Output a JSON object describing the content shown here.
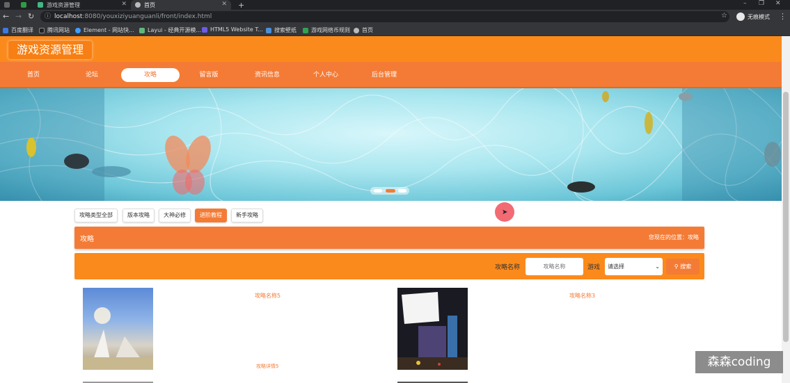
{
  "browser": {
    "tabs": [
      {
        "title": ""
      },
      {
        "title": ""
      },
      {
        "title": "游戏资源管理"
      },
      {
        "title": "首页"
      }
    ],
    "url_host": "localhost",
    "url_path": ":8080/youxiziyuanguanli/front/index.html",
    "profile": "无痕模式",
    "bookmarks": [
      "百度翻译",
      "腾讯网站",
      "Element - 网站快...",
      "Layui - 经典开源模...",
      "HTML5 Website T...",
      "搜索壁纸",
      "游戏网络币规则",
      "首页"
    ]
  },
  "site": {
    "title": "游戏资源管理",
    "nav": [
      "首页",
      "论坛",
      "攻略",
      "留言版",
      "资讯信息",
      "个人中心",
      "后台管理"
    ],
    "active_nav": "攻略"
  },
  "categories": [
    "攻略类型全部",
    "版本攻略",
    "大神必修",
    "进阶教程",
    "新手攻略"
  ],
  "active_category": "进阶教程",
  "section": {
    "title": "攻略",
    "breadcrumb": "您现在的位置：攻略"
  },
  "search": {
    "name_label": "攻略名称",
    "name_placeholder": "攻略名称",
    "game_label": "游戏",
    "game_selected": "请选择",
    "button": "搜索"
  },
  "cards": [
    {
      "name": "攻略名称5",
      "detail": "攻略详情5"
    },
    {
      "name": "攻略名称3",
      "detail": ""
    }
  ],
  "watermark": "森森coding",
  "colors": {
    "accent": "#f47b35",
    "header": "#fb8a1c"
  }
}
